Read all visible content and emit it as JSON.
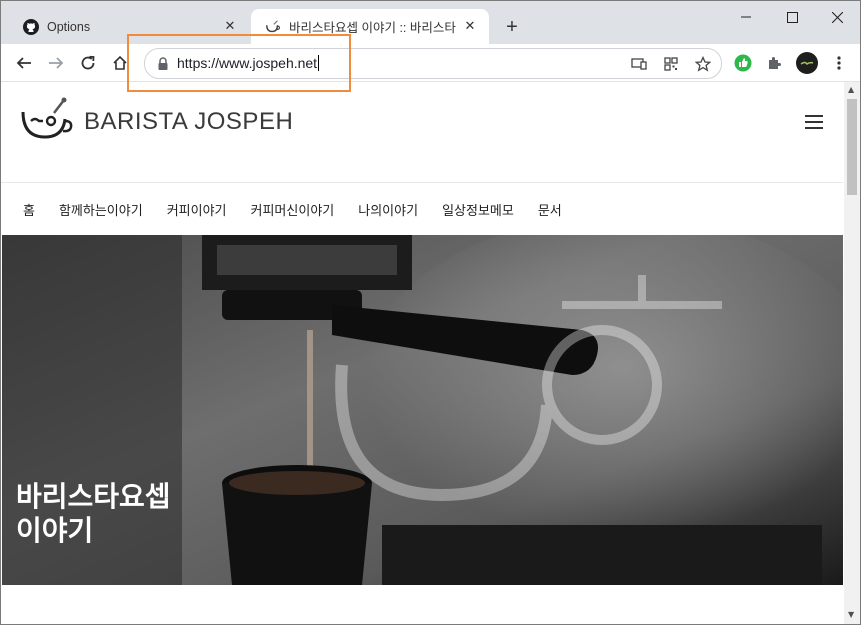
{
  "browser": {
    "tabs": [
      {
        "title": "Options",
        "favicon": "github-icon",
        "active": false
      },
      {
        "title": "바리스타요셉 이야기 :: 바리스타",
        "favicon": "coffee-logo-icon",
        "active": true
      }
    ],
    "address_bar": {
      "url": "https://www.jospeh.net"
    },
    "toolbar_icons": [
      "back-arrow-icon",
      "forward-arrow-icon",
      "reload-icon",
      "home-icon",
      "cast-icon",
      "qr-code-icon",
      "bookmark-star-icon",
      "green-extension-icon",
      "puzzle-extensions-icon",
      "profile-avatar-icon",
      "kebab-menu-icon"
    ],
    "highlight_color": "#f08c3b"
  },
  "site": {
    "logo_text": "BARISTA JOSPEH",
    "nav": [
      "홈",
      "함께하는이야기",
      "커피이야기",
      "커피머신이야기",
      "나의이야기",
      "일상정보메모",
      "문서"
    ],
    "hero": {
      "title_line1": "바리스타요셉",
      "title_line2": "이야기"
    }
  }
}
